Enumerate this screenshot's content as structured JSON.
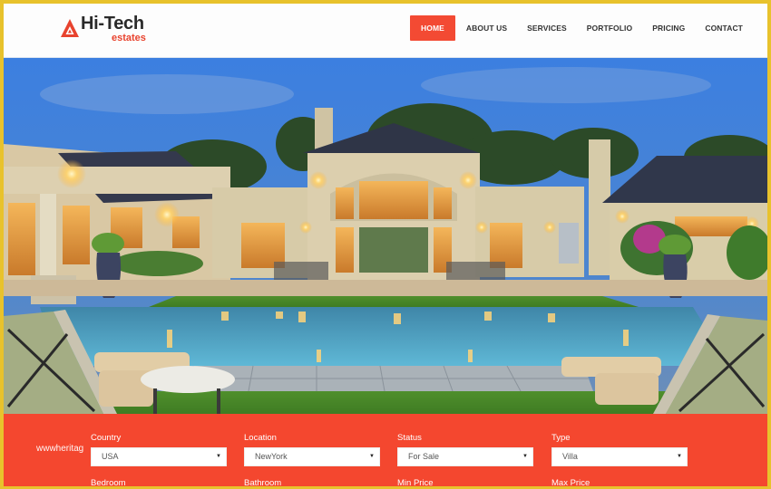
{
  "brand": {
    "title": "Hi-Tech",
    "subtitle": "estates",
    "accent_color": "#f34a33"
  },
  "nav": {
    "items": [
      {
        "label": "HOME",
        "active": true
      },
      {
        "label": "ABOUT US",
        "active": false
      },
      {
        "label": "SERVICES",
        "active": false
      },
      {
        "label": "PORTFOLIO",
        "active": false
      },
      {
        "label": "PRICING",
        "active": false
      },
      {
        "label": "CONTACT",
        "active": false
      }
    ]
  },
  "hero": {
    "image": "luxury-house-with-pool-at-dusk",
    "slider": {
      "count": 3,
      "active_index": 1
    }
  },
  "search": {
    "fields": [
      {
        "label": "Country",
        "value": "USA"
      },
      {
        "label": "Location",
        "value": "NewYork"
      },
      {
        "label": "Status",
        "value": "For Sale"
      },
      {
        "label": "Type",
        "value": "Villa"
      }
    ],
    "second_row_labels": [
      "Bedroom",
      "Bathroom",
      "Min Price",
      "Max Price"
    ],
    "background_color": "#f4472f"
  },
  "watermark": "wwwheritag"
}
